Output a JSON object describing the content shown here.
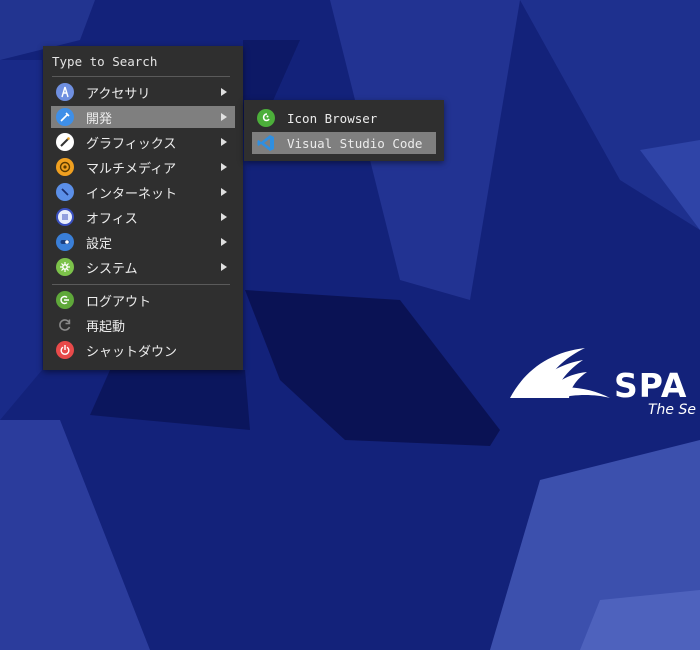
{
  "main_menu": {
    "search_label": "Type to Search",
    "items": [
      {
        "label": "アクセサリ",
        "icon": "accessories-icon",
        "color": "#6f8fe0",
        "has_submenu": true
      },
      {
        "label": "開発",
        "icon": "development-icon",
        "color": "#3e8fe8",
        "has_submenu": true,
        "active": true
      },
      {
        "label": "グラフィックス",
        "icon": "graphics-icon",
        "color": "#ffffff",
        "has_submenu": true
      },
      {
        "label": "マルチメディア",
        "icon": "multimedia-icon",
        "color": "#f0a020",
        "has_submenu": true
      },
      {
        "label": "インターネット",
        "icon": "internet-icon",
        "color": "#5b8fe8",
        "has_submenu": true
      },
      {
        "label": "オフィス",
        "icon": "office-icon",
        "color": "#e8eefc",
        "has_submenu": true
      },
      {
        "label": "設定",
        "icon": "settings-icon",
        "color": "#3a7fd8",
        "has_submenu": true
      },
      {
        "label": "システム",
        "icon": "system-icon",
        "color": "#7cc24a",
        "has_submenu": true
      }
    ],
    "session_items": [
      {
        "label": "ログアウト",
        "icon": "logout-icon",
        "color": "#5fa83a"
      },
      {
        "label": "再起動",
        "icon": "restart-icon",
        "color": "#8a8a8a"
      },
      {
        "label": "シャットダウン",
        "icon": "shutdown-icon",
        "color": "#e84a4a"
      }
    ]
  },
  "sub_menu": {
    "items": [
      {
        "label": "Icon Browser",
        "icon": "icon-browser-icon",
        "color": "#4caf3a"
      },
      {
        "label": "Visual Studio Code",
        "icon": "vscode-icon",
        "color": "#2f8fe0",
        "active": true
      }
    ]
  },
  "wallpaper": {
    "logo_text": "SPA",
    "tagline": "The Se",
    "background_color": "#14237e"
  }
}
